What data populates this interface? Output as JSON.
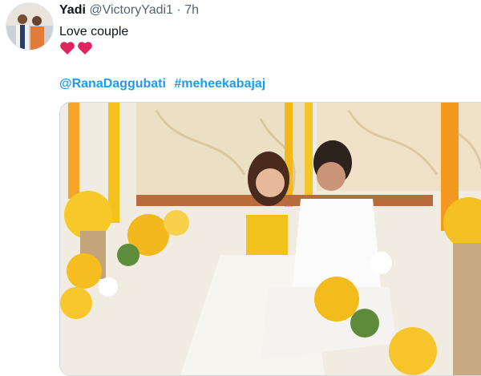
{
  "tweet": {
    "author_name": "Yadi",
    "handle": "@VictoryYadi1",
    "separator": "·",
    "time": "7h",
    "text": "Love couple",
    "emoji": [
      "red-heart",
      "red-heart"
    ],
    "mentions": [
      "@RanaDaggubati",
      "#meheekabajaj"
    ]
  },
  "colors": {
    "link": "#1d9bf0",
    "secondary_text": "#536471",
    "heart": "#e0245e"
  },
  "icons": {
    "avatar": "profile-photo",
    "media": "wedding-photo-couple-yellow-flowers"
  }
}
